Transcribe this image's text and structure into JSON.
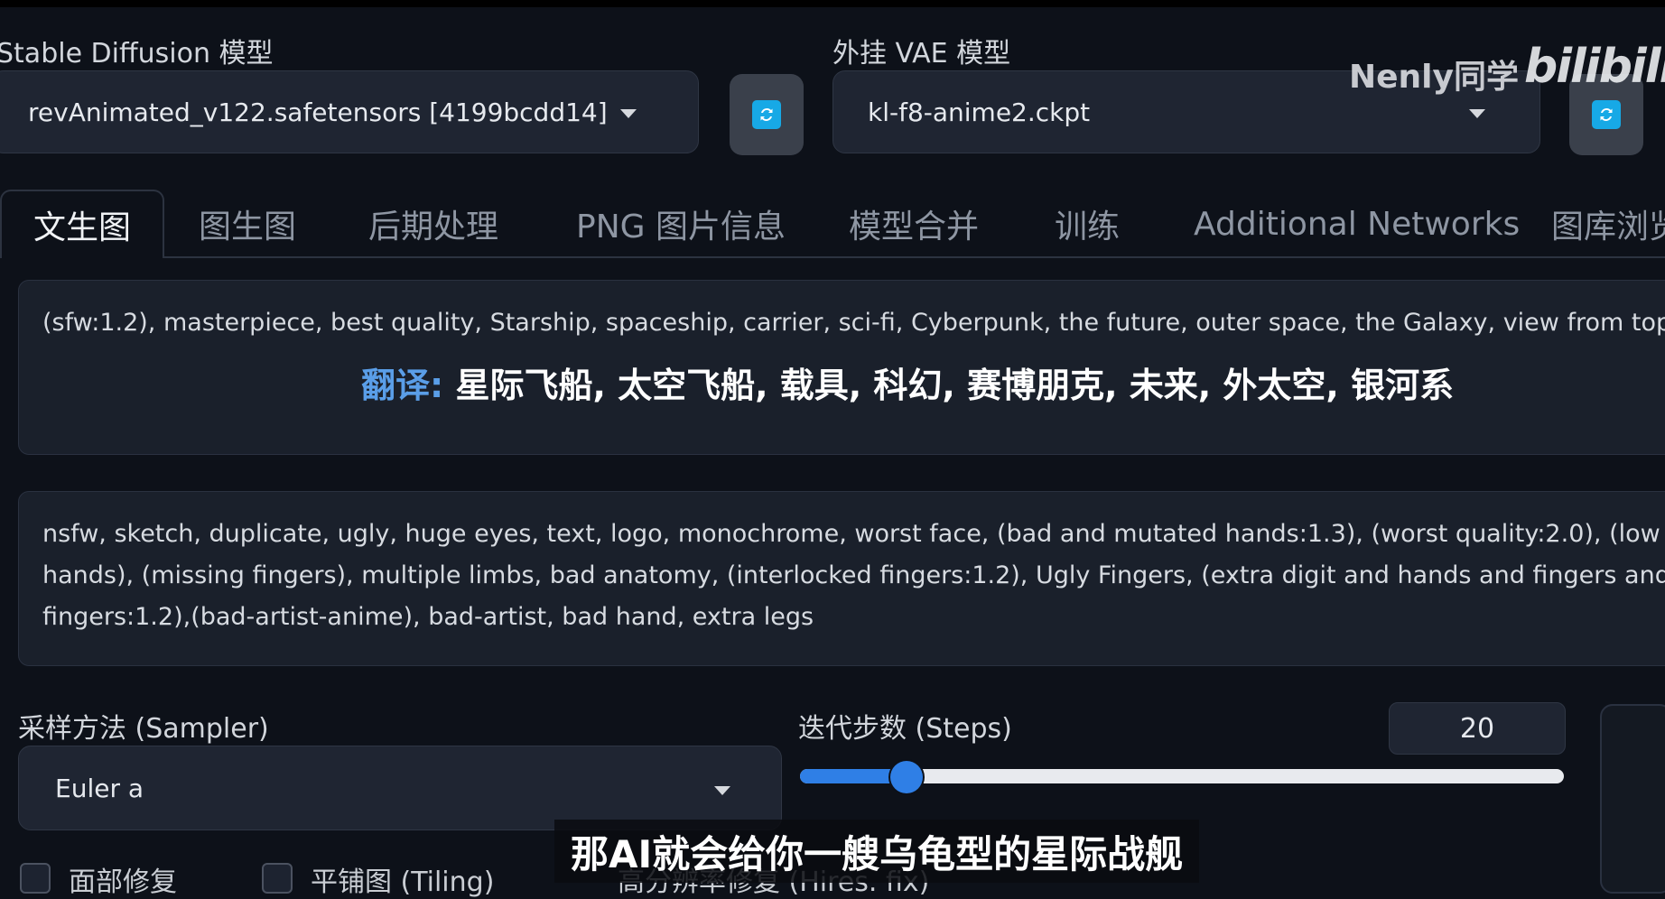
{
  "top": {
    "sd_model_label": "Stable Diffusion 模型",
    "sd_model_value": "revAnimated_v122.safetensors [4199bcdd14]",
    "vae_label": "外挂 VAE 模型",
    "vae_value": "kl-f8-anime2.ckpt"
  },
  "watermark": {
    "author": "Nenly同学",
    "site": "bilibili"
  },
  "tabs": [
    {
      "label": "文生图",
      "active": true
    },
    {
      "label": "图生图"
    },
    {
      "label": "后期处理"
    },
    {
      "label": "PNG 图片信息"
    },
    {
      "label": "模型合并"
    },
    {
      "label": "训练"
    },
    {
      "label": "Additional Networks"
    },
    {
      "label": "图库浏览"
    }
  ],
  "prompt": {
    "text": "(sfw:1.2), masterpiece, best quality, Starship, spaceship, carrier, sci-fi, Cyberpunk, the future, outer space, the Galaxy, view from top, t",
    "translation_label": "翻译:",
    "translation_text": "星际飞船, 太空飞船, 载具, 科幻, 赛博朋克, 未来, 外太空, 银河系"
  },
  "negative_prompt": {
    "lines": [
      "nsfw, sketch, duplicate, ugly, huge eyes, text, logo, monochrome, worst face, (bad and mutated hands:1.3), (worst quality:2.0), (low qu",
      "hands), (missing fingers), multiple limbs, bad anatomy, (interlocked fingers:1.2), Ugly Fingers, (extra digit and hands and fingers and l",
      "fingers:1.2),(bad-artist-anime), bad-artist, bad hand, extra legs"
    ]
  },
  "sampler": {
    "label": "采样方法 (Sampler)",
    "value": "Euler a"
  },
  "steps": {
    "label": "迭代步数 (Steps)",
    "value": "20",
    "fraction": 0.14
  },
  "checkboxes": [
    {
      "label": "面部修复"
    },
    {
      "label": "平铺图 (Tiling)"
    },
    {
      "label": "高分辨率修复 (Hires. fix)"
    }
  ],
  "subtitle": "那AI就会给你一艘乌龟型的星际战舰",
  "colors": {
    "accent": "#2f7fe6",
    "refresh_icon": "#17a9e6",
    "background": "#0d1119"
  }
}
